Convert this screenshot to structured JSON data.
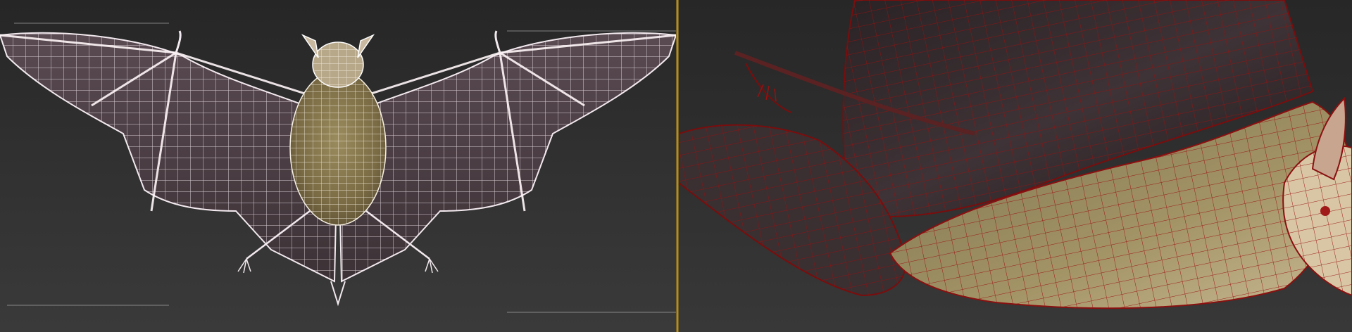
{
  "app": {
    "viewports": [
      {
        "id": "left",
        "view": "",
        "shading": "wireframe-over-textured"
      },
      {
        "id": "right",
        "view": "",
        "shading": "red-wireframe-over-textured"
      }
    ]
  },
  "colors": {
    "viewport_background": "#2e2e2e",
    "active_viewport_border": "#c9a53a",
    "wireframe_left": "#f2e9ee",
    "wireframe_right": "#9a1010",
    "bat_fur": "#8a7a50",
    "bat_membrane": "#4a3c40"
  },
  "scene": {
    "object_name": "",
    "subject": "bat-model"
  }
}
